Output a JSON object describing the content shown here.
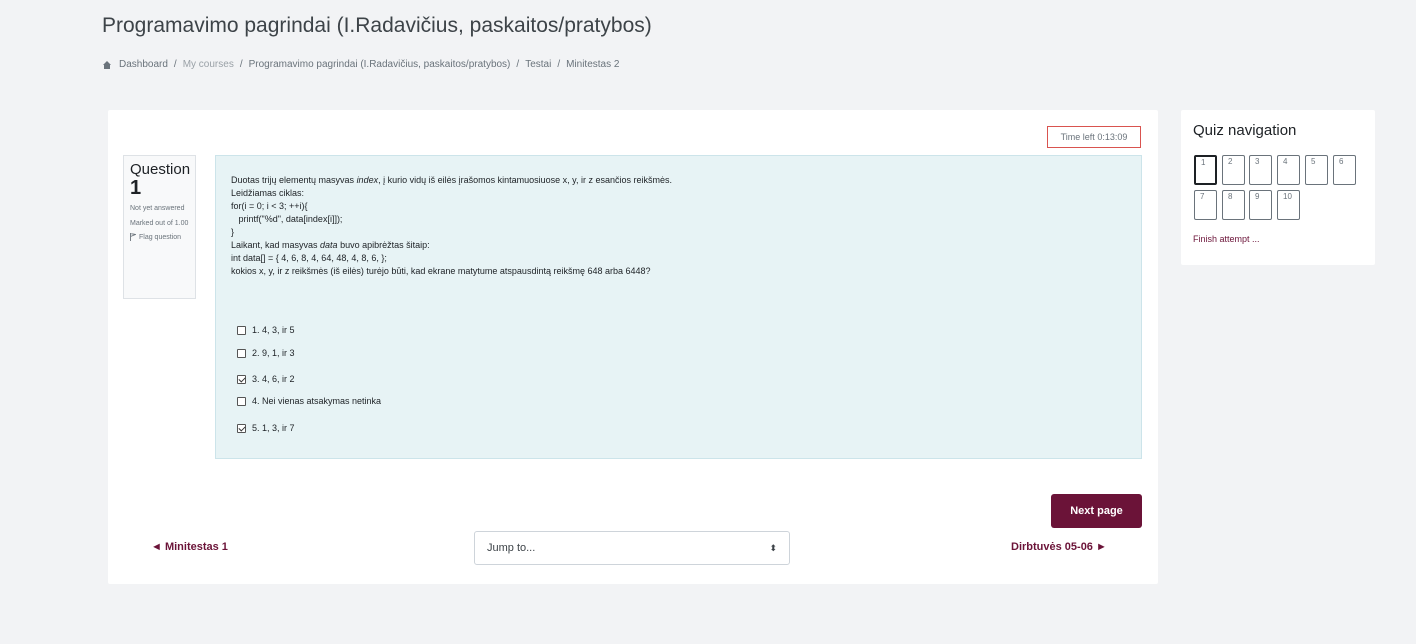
{
  "header": {
    "title": "Programavimo pagrindai (I.Radavičius, paskaitos/pratybos)",
    "breadcrumb": [
      "Dashboard",
      "My courses",
      "Programavimo pagrindai (I.Radavičius, paskaitos/pratybos)",
      "Testai",
      "Minitestas 2"
    ],
    "separator": "/"
  },
  "timer": {
    "label": "Time left 0:13:09"
  },
  "question": {
    "word": "Question",
    "number": "1",
    "status": "Not yet answered",
    "marked": "Marked out of 1.00",
    "flag_label": "Flag question",
    "text_line1_a": "Duotas trijų elementų masyvas ",
    "text_line1_em": "index",
    "text_line1_b": ", į kurio vidų iš eilės įrašomos kintamuosiuose x, y, ir z esančios reikšmės.",
    "text_line2": "Leidžiamas ciklas:",
    "text_line3": "for(i = 0; i < 3; ++i){",
    "text_line4": "   printf(\"%d\", data[index[i]]);",
    "text_line5": "}",
    "text_line6_a": "Laikant, kad masyvas ",
    "text_line6_em": "data",
    "text_line6_b": " buvo apibrėžtas šitaip:",
    "text_line7": "int data[] = { 4, 6, 8, 4, 64, 48, 4, 8, 6, };",
    "text_line8": "kokios x, y, ir z reikšmės (iš eilės) turėjo būti, kad ekrane matytume atspausdintą reikšmę 648 arba 6448?",
    "answers": [
      {
        "label": "1. 4, 3, ir 5",
        "checked": false
      },
      {
        "label": "2. 9, 1, ir 3",
        "checked": false
      },
      {
        "label": "3. 4, 6, ir 2",
        "checked": true
      },
      {
        "label": "4. Nei vienas atsakymas netinka",
        "checked": false
      },
      {
        "label": "5. 1, 3, ir 7",
        "checked": true
      }
    ]
  },
  "navigation_bar": {
    "next_button": "Next page",
    "prev_link": "◄ Minitestas 1",
    "next_link": "Dirbtuvės 05-06 ►",
    "jump_label": "Jump to...",
    "jump_arrows": "⬍"
  },
  "quiz_nav": {
    "title": "Quiz navigation",
    "buttons": [
      "1",
      "2",
      "3",
      "4",
      "5",
      "6",
      "7",
      "8",
      "9",
      "10"
    ],
    "current": "1",
    "finish": "Finish attempt ..."
  },
  "colors": {
    "accent": "#6b1338",
    "question_bg": "#e7f3f5",
    "timer_border": "#d9534f"
  }
}
